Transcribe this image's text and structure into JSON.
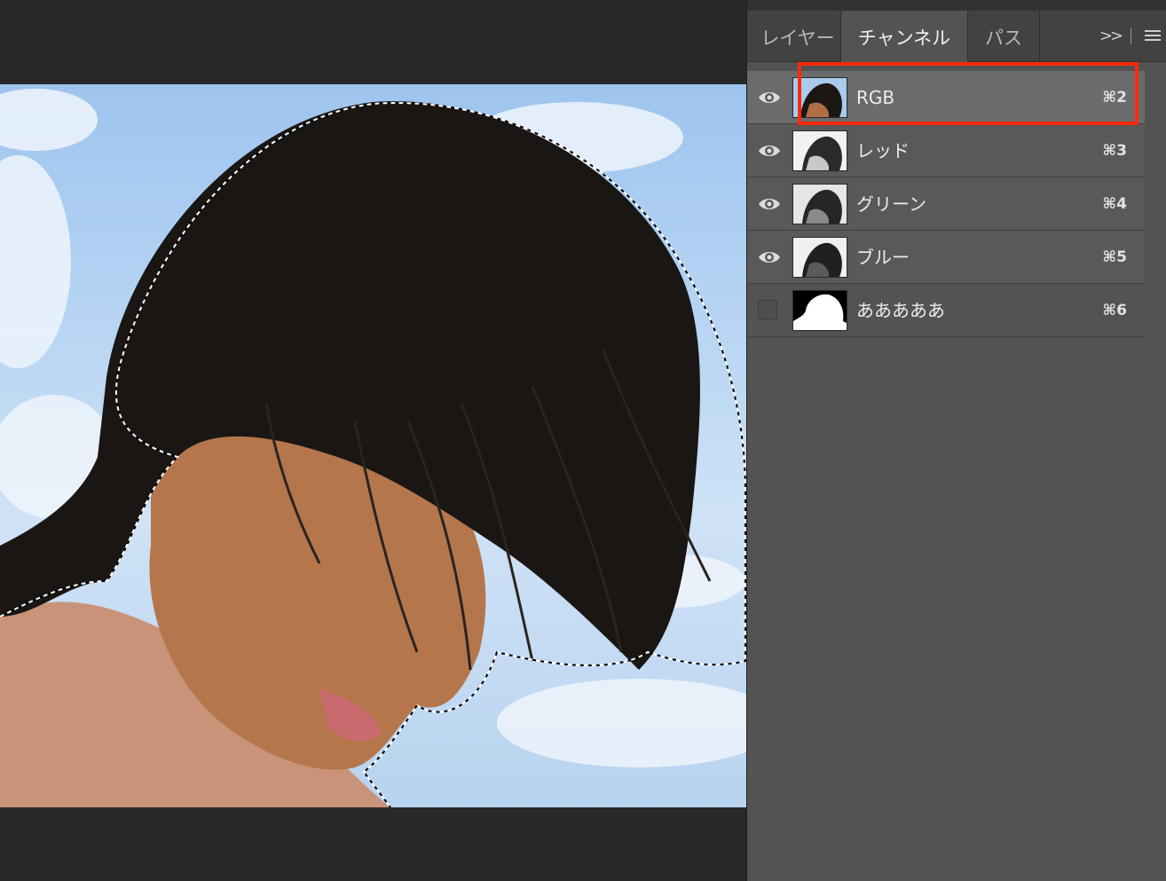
{
  "panel": {
    "tabs": [
      {
        "label": "レイヤー",
        "active": false
      },
      {
        "label": "チャンネル",
        "active": true
      },
      {
        "label": "パス",
        "active": false
      }
    ],
    "overflow_icon": "double-chevron-right-icon",
    "menu_icon": "hamburger-menu-icon"
  },
  "channels": [
    {
      "name": "RGB",
      "shortcut": "⌘2",
      "visible": true,
      "selected": true,
      "thumbnail": "color"
    },
    {
      "name": "レッド",
      "shortcut": "⌘3",
      "visible": true,
      "selected": true,
      "thumbnail": "grayscale-light"
    },
    {
      "name": "グリーン",
      "shortcut": "⌘4",
      "visible": true,
      "selected": true,
      "thumbnail": "grayscale"
    },
    {
      "name": "ブルー",
      "shortcut": "⌘5",
      "visible": true,
      "selected": true,
      "thumbnail": "grayscale"
    },
    {
      "name": "あああああ",
      "shortcut": "⌘6",
      "visible": false,
      "selected": false,
      "thumbnail": "mask"
    }
  ],
  "annotation": {
    "color": "#ff2a0a",
    "target": "RGB channel thumbnail and name"
  },
  "colors": {
    "panel_bg": "#535353",
    "canvas_bg": "#282828",
    "sky": "#b9d6f3"
  }
}
